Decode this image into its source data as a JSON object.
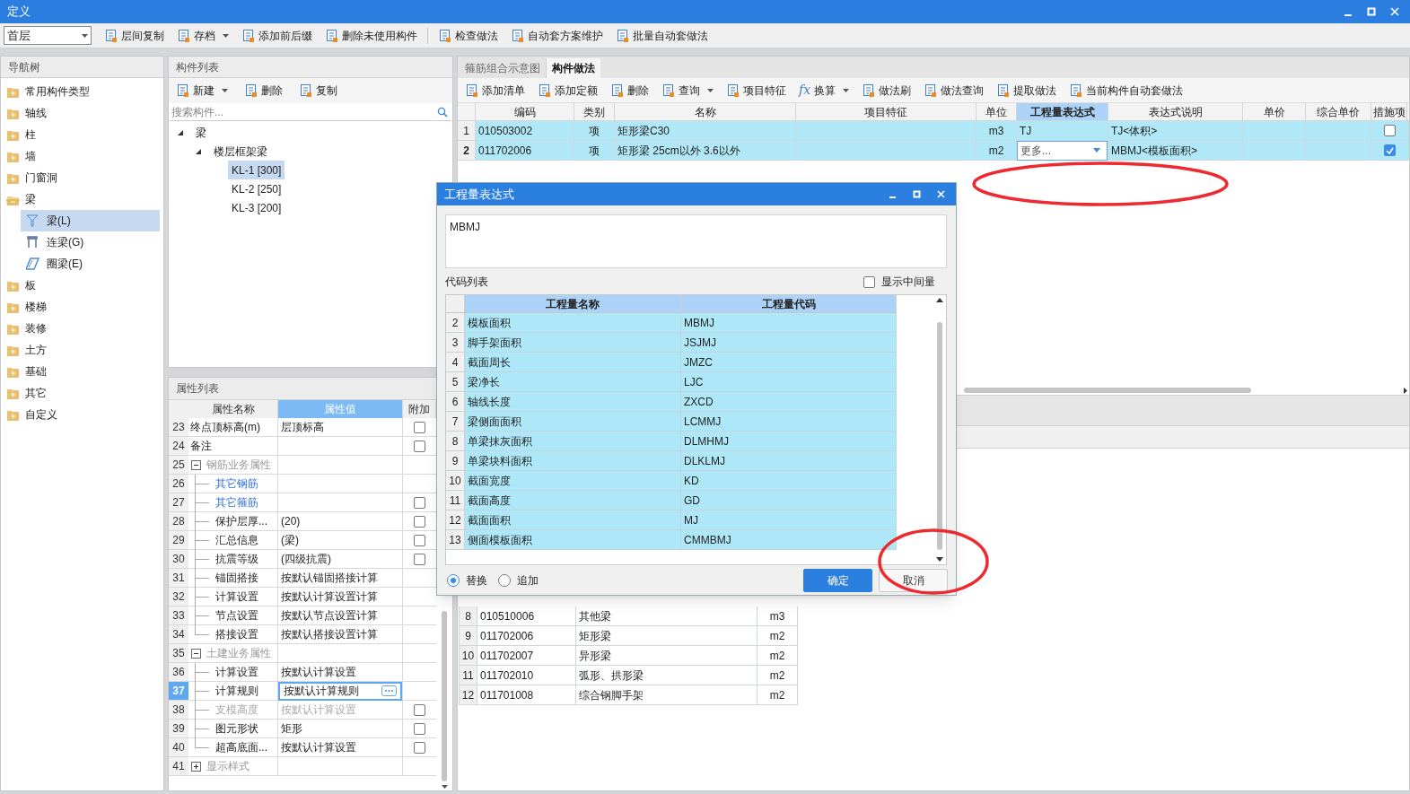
{
  "window": {
    "title": "定义"
  },
  "toolbar": {
    "floor_select": "首层",
    "buttons": [
      {
        "label": "层间复制",
        "menu": false
      },
      {
        "label": "存档",
        "menu": true
      },
      {
        "label": "添加前后缀",
        "menu": false
      },
      {
        "label": "删除未使用构件",
        "menu": false
      },
      {
        "label": "检查做法",
        "menu": false
      },
      {
        "label": "自动套方案维护",
        "menu": false
      },
      {
        "label": "批量自动套做法",
        "menu": false
      }
    ]
  },
  "nav_tree": {
    "title": "导航树",
    "items": [
      {
        "label": "常用构件类型",
        "expanded": false
      },
      {
        "label": "轴线",
        "expanded": false
      },
      {
        "label": "柱",
        "expanded": false
      },
      {
        "label": "墙",
        "expanded": false
      },
      {
        "label": "门窗洞",
        "expanded": false
      },
      {
        "label": "梁",
        "expanded": true,
        "children": [
          {
            "label": "梁(L)",
            "selected": true
          },
          {
            "label": "连梁(G)",
            "selected": false
          },
          {
            "label": "圈梁(E)",
            "selected": false
          }
        ]
      },
      {
        "label": "板",
        "expanded": false
      },
      {
        "label": "楼梯",
        "expanded": false
      },
      {
        "label": "装修",
        "expanded": false
      },
      {
        "label": "土方",
        "expanded": false
      },
      {
        "label": "基础",
        "expanded": false
      },
      {
        "label": "其它",
        "expanded": false
      },
      {
        "label": "自定义",
        "expanded": false
      }
    ]
  },
  "component_list": {
    "title": "构件列表",
    "buttons": [
      {
        "label": "新建",
        "menu": true
      },
      {
        "label": "删除",
        "menu": false
      },
      {
        "label": "复制",
        "menu": false
      }
    ],
    "search": {
      "placeholder": "搜索构件..."
    },
    "tree": [
      {
        "label": "梁",
        "expanded": true,
        "selected": false,
        "children": [
          {
            "label": "楼层框架梁",
            "expanded": true,
            "selected": false,
            "children": [
              {
                "label": "KL-1 [300]",
                "selected": true
              },
              {
                "label": "KL-2 [250]",
                "selected": false
              },
              {
                "label": "KL-3 [200]",
                "selected": false
              }
            ]
          }
        ]
      }
    ]
  },
  "property_list": {
    "title": "属性列表",
    "columns": [
      {
        "label": "属性名称",
        "selected": false
      },
      {
        "label": "属性值",
        "selected": true
      },
      {
        "label": "附加",
        "selected": false
      }
    ],
    "rows": [
      {
        "num": "23",
        "kind": "prop",
        "name": "终点顶标高(m)",
        "value": "层顶标高",
        "checked": false,
        "selected": false,
        "disabled": false
      },
      {
        "num": "24",
        "kind": "prop",
        "name": "备注",
        "checked": false,
        "selected": false,
        "disabled": false
      },
      {
        "num": "25",
        "kind": "group",
        "name": "钢筋业务属性",
        "expanded": true,
        "children": [
          {
            "num": "26",
            "kind": "link",
            "name": "其它钢筋",
            "selected": false,
            "disabled": false
          },
          {
            "num": "27",
            "kind": "link",
            "name": "其它箍筋",
            "checked": false,
            "selected": false,
            "disabled": false
          },
          {
            "num": "28",
            "kind": "prop",
            "name": "保护层厚...",
            "value": "(20)",
            "checked": false,
            "selected": false,
            "disabled": false
          },
          {
            "num": "29",
            "kind": "prop",
            "name": "汇总信息",
            "value": "(梁)",
            "checked": false,
            "selected": false,
            "disabled": false
          },
          {
            "num": "30",
            "kind": "prop",
            "name": "抗震等级",
            "value": "(四级抗震)",
            "checked": false,
            "selected": false,
            "disabled": false
          },
          {
            "num": "31",
            "kind": "prop",
            "name": "锚固搭接",
            "value": "按默认锚固搭接计算",
            "selected": false,
            "disabled": false
          },
          {
            "num": "32",
            "kind": "prop",
            "name": "计算设置",
            "value": "按默认计算设置计算",
            "selected": false,
            "disabled": false
          },
          {
            "num": "33",
            "kind": "prop",
            "name": "节点设置",
            "value": "按默认节点设置计算",
            "selected": false,
            "disabled": false
          },
          {
            "num": "34",
            "kind": "prop",
            "name": "搭接设置",
            "value": "按默认搭接设置计算",
            "selected": false,
            "disabled": false
          }
        ]
      },
      {
        "num": "35",
        "kind": "group",
        "name": "土建业务属性",
        "expanded": true,
        "children": [
          {
            "num": "36",
            "kind": "prop",
            "name": "计算设置",
            "value": "按默认计算设置",
            "selected": false,
            "disabled": false
          },
          {
            "num": "37",
            "kind": "prop",
            "name": "计算规则",
            "value": "按默认计算规则",
            "selected": true,
            "disabled": false
          },
          {
            "num": "38",
            "kind": "prop",
            "name": "支模高度",
            "value": "按默认计算设置",
            "checked": false,
            "selected": false,
            "disabled": true
          },
          {
            "num": "39",
            "kind": "prop",
            "name": "图元形状",
            "value": "矩形",
            "checked": false,
            "selected": false,
            "disabled": false
          },
          {
            "num": "40",
            "kind": "prop",
            "name": "超高底面...",
            "value": "按默认计算设置",
            "checked": false,
            "selected": false,
            "disabled": false
          }
        ]
      },
      {
        "num": "41",
        "kind": "group",
        "name": "显示样式",
        "expanded": false
      }
    ]
  },
  "method_panel": {
    "tabs": [
      {
        "label": "箍筋组合示意图",
        "selected": false
      },
      {
        "label": "构件做法",
        "selected": true
      }
    ],
    "buttons": [
      {
        "label": "添加清单",
        "menu": false
      },
      {
        "label": "添加定额",
        "menu": false
      },
      {
        "label": "删除",
        "menu": false
      },
      {
        "label": "查询",
        "menu": true
      },
      {
        "label": "项目特征",
        "menu": false
      },
      {
        "label": "换算",
        "menu": true,
        "icon_text": "fx"
      },
      {
        "label": "做法刷",
        "menu": false
      },
      {
        "label": "做法查询",
        "menu": false
      },
      {
        "label": "提取做法",
        "menu": false
      },
      {
        "label": "当前构件自动套做法",
        "menu": false
      }
    ],
    "columns": [
      {
        "label": "编码",
        "selected": false
      },
      {
        "label": "类别",
        "selected": false
      },
      {
        "label": "名称",
        "selected": false
      },
      {
        "label": "项目特征",
        "selected": false
      },
      {
        "label": "单位",
        "selected": false
      },
      {
        "label": "工程量表达式",
        "selected": true
      },
      {
        "label": "表达式说明",
        "selected": false
      },
      {
        "label": "单价",
        "selected": false
      },
      {
        "label": "综合单价",
        "selected": false
      },
      {
        "label": "措施项",
        "selected": false
      }
    ],
    "rows": [
      {
        "num": "1",
        "code": "010503002",
        "type": "项",
        "name": "矩形梁C30",
        "unit": "m3",
        "expression": "TJ",
        "expression_desc": "TJ<体积>",
        "measure_checked": false,
        "selected": false,
        "editing": false
      },
      {
        "num": "2",
        "code": "011702006",
        "type": "项",
        "name": "矩形梁 25cm以外 3.6以外",
        "unit": "m2",
        "expression": "更多...",
        "expression_desc": "MBMJ<模板面积>",
        "measure_checked": true,
        "selected": true,
        "editing": true
      }
    ]
  },
  "lower_table": {
    "rows": [
      {
        "num": "8",
        "code": "010510006",
        "name": "其他梁",
        "unit": "m3"
      },
      {
        "num": "9",
        "code": "011702006",
        "name": "矩形梁",
        "unit": "m2"
      },
      {
        "num": "10",
        "code": "011702007",
        "name": "异形梁",
        "unit": "m2"
      },
      {
        "num": "11",
        "code": "011702010",
        "name": "弧形、拱形梁",
        "unit": "m2"
      },
      {
        "num": "12",
        "code": "011701008",
        "name": "综合钢脚手架",
        "unit": "m2"
      }
    ]
  },
  "dialog": {
    "title": "工程量表达式",
    "expression": "MBMJ",
    "code_list_label": "代码列表",
    "show_intermediate": {
      "label": "显示中间量",
      "checked": false
    },
    "columns": [
      "工程量名称",
      "工程量代码"
    ],
    "rows": [
      {
        "num": "2",
        "name": "模板面积",
        "code": "MBMJ"
      },
      {
        "num": "3",
        "name": "脚手架面积",
        "code": "JSJMJ"
      },
      {
        "num": "4",
        "name": "截面周长",
        "code": "JMZC"
      },
      {
        "num": "5",
        "name": "梁净长",
        "code": "LJC"
      },
      {
        "num": "6",
        "name": "轴线长度",
        "code": "ZXCD"
      },
      {
        "num": "7",
        "name": "梁侧面面积",
        "code": "LCMMJ"
      },
      {
        "num": "8",
        "name": "单梁抹灰面积",
        "code": "DLMHMJ"
      },
      {
        "num": "9",
        "name": "单梁块料面积",
        "code": "DLKLMJ"
      },
      {
        "num": "10",
        "name": "截面宽度",
        "code": "KD"
      },
      {
        "num": "11",
        "name": "截面高度",
        "code": "GD"
      },
      {
        "num": "12",
        "name": "截面面积",
        "code": "MJ"
      },
      {
        "num": "13",
        "name": "侧面模板面积",
        "code": "CMMBMJ"
      }
    ],
    "modes": [
      {
        "label": "替换",
        "selected": true
      },
      {
        "label": "追加",
        "selected": false
      }
    ],
    "buttons": [
      {
        "label": "确定",
        "kind": "primary"
      },
      {
        "label": "取消",
        "kind": "secondary"
      }
    ]
  }
}
